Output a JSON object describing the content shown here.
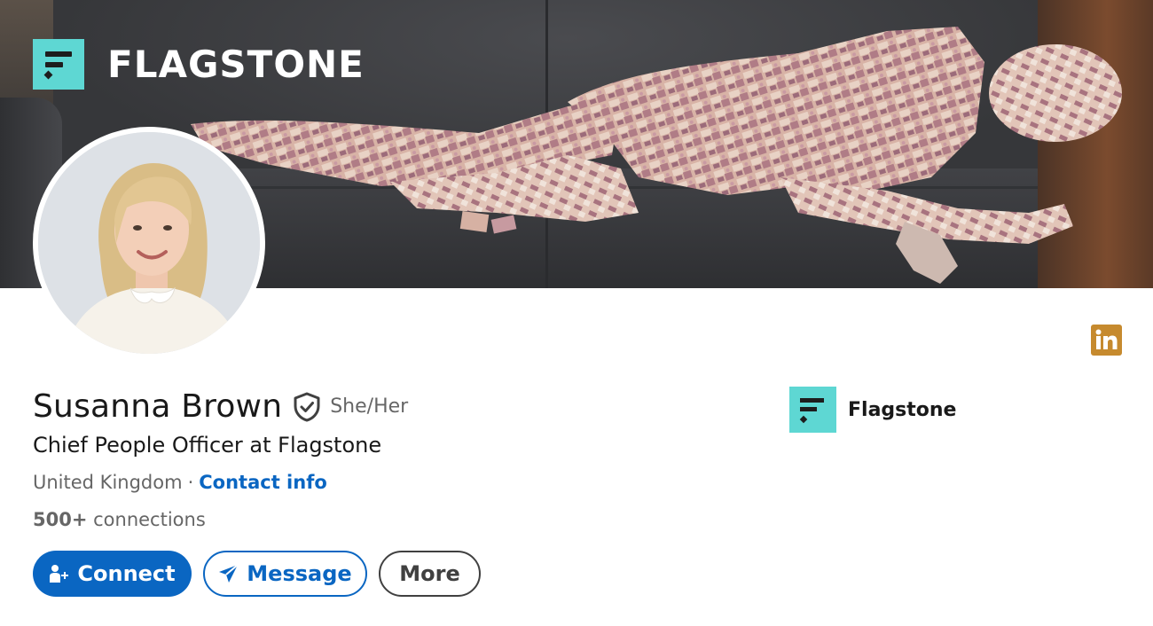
{
  "banner": {
    "brand_name": "FLAGSTONE",
    "brand_color": "#5ed7d3"
  },
  "profile": {
    "name": "Susanna Brown",
    "pronouns": "She/Her",
    "headline": "Chief People Officer at Flagstone",
    "location": "United Kingdom",
    "separator": "·",
    "contact_info_label": "Contact info",
    "connections_count": "500+",
    "connections_label": "connections",
    "verified_icon": "verified-shield-icon"
  },
  "company": {
    "name": "Flagstone",
    "logo_icon": "flagstone-logo-icon"
  },
  "actions": {
    "connect_label": "Connect",
    "message_label": "Message",
    "more_label": "More"
  },
  "colors": {
    "primary_blue": "#0a66c2",
    "linkedin_badge": "#c68a2e",
    "brand_teal": "#5ed7d3"
  },
  "icons": {
    "linkedin": "linkedin-icon",
    "connect": "add-person-icon",
    "message": "send-icon"
  }
}
